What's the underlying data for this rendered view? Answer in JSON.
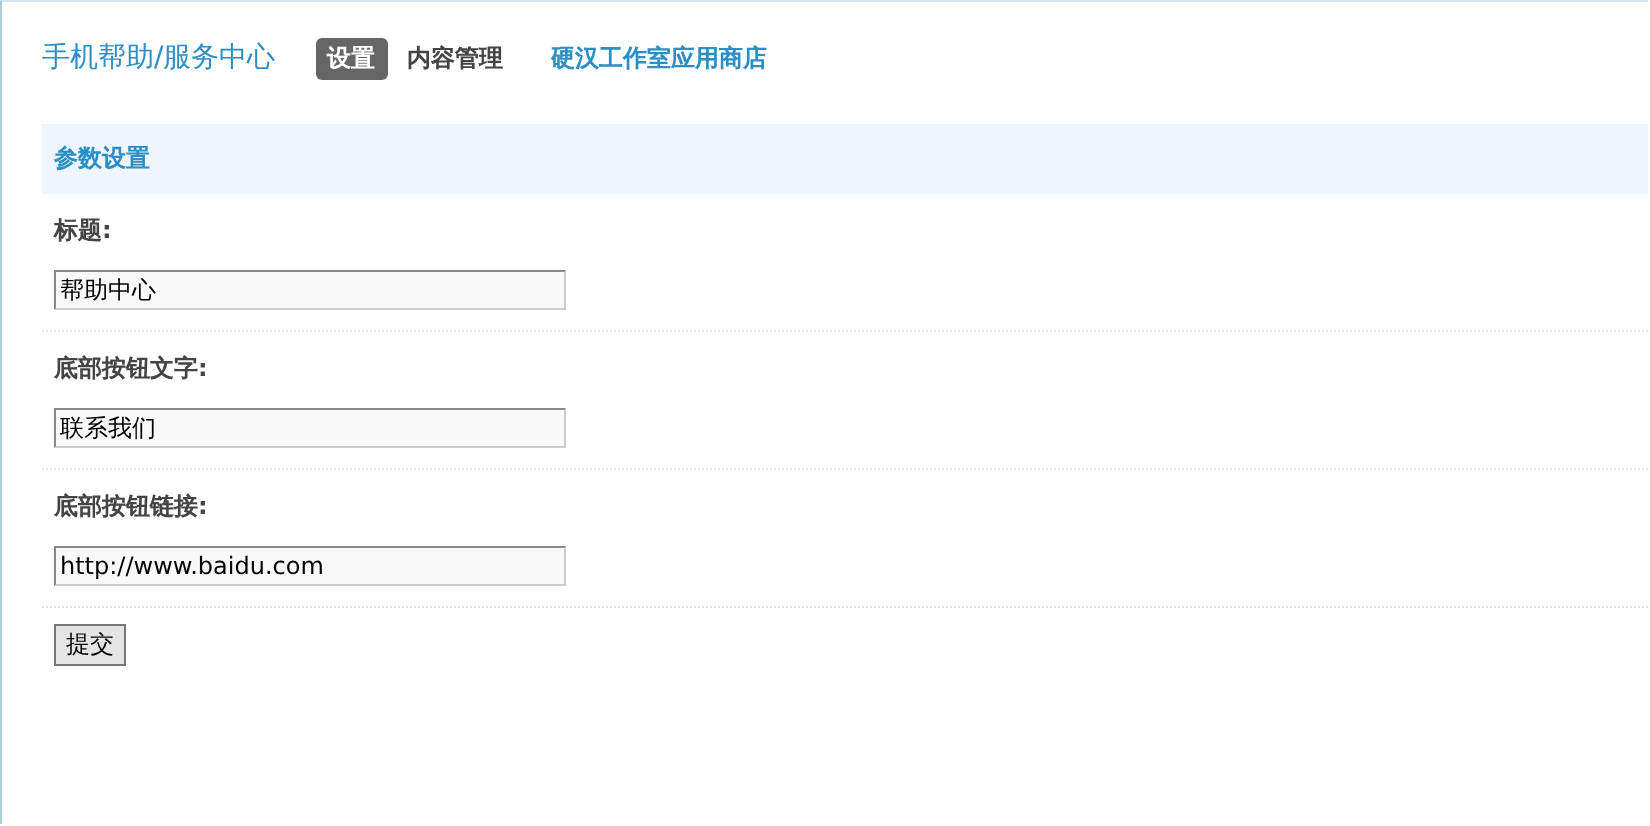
{
  "header": {
    "title": "手机帮助/服务中心",
    "tabs": [
      {
        "label": "设置",
        "selected": true
      },
      {
        "label": "内容管理",
        "selected": false
      }
    ],
    "store_link": "硬汉工作室应用商店"
  },
  "section": {
    "title": "参数设置"
  },
  "fields": [
    {
      "label": "标题:",
      "value": "帮助中心"
    },
    {
      "label": "底部按钮文字:",
      "value": "联系我们"
    },
    {
      "label": "底部按钮链接:",
      "value": "http://www.baidu.com"
    }
  ],
  "submit": "提交"
}
